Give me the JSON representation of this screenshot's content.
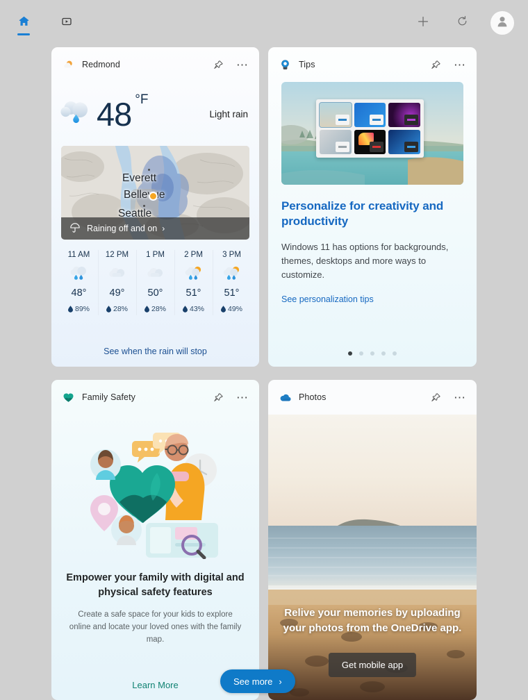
{
  "topbar": {
    "nav": [
      {
        "name": "home",
        "icon": "home-icon",
        "active": true
      },
      {
        "name": "video",
        "icon": "video-icon",
        "active": false
      }
    ],
    "actions": [
      {
        "name": "add",
        "icon": "plus-icon"
      },
      {
        "name": "refresh",
        "icon": "refresh-icon"
      },
      {
        "name": "account",
        "icon": "avatar-icon"
      }
    ]
  },
  "weather": {
    "title": "Redmond",
    "icon": "partly-sunny-icon",
    "pin_icon": "pin-icon",
    "more_icon": "more-options-icon",
    "temperature": "48",
    "unit": "°F",
    "condition": "Light rain",
    "current_icon": "rain-cloud-icon",
    "map": {
      "labels": [
        "Everett",
        "Bellevue",
        "Seattle"
      ],
      "overlay_icon": "umbrella-icon",
      "overlay_text": "Raining off and on",
      "overlay_chevron": "›"
    },
    "hourly": [
      {
        "time": "11 AM",
        "icon": "rain-icon",
        "temp": "48°",
        "precip": "89%"
      },
      {
        "time": "12 PM",
        "icon": "cloud-icon",
        "temp": "49°",
        "precip": "28%"
      },
      {
        "time": "1 PM",
        "icon": "cloud-icon",
        "temp": "50°",
        "precip": "28%"
      },
      {
        "time": "2 PM",
        "icon": "sun-rain-icon",
        "temp": "51°",
        "precip": "43%"
      },
      {
        "time": "3 PM",
        "icon": "sun-rain-icon",
        "temp": "51°",
        "precip": "49%"
      }
    ],
    "footer_link": "See when the rain will stop"
  },
  "tips": {
    "title": "Tips",
    "icon": "tips-lightbulb-icon",
    "pin_icon": "pin-icon",
    "more_icon": "more-options-icon",
    "image_alt": "personalization-settings-thumbnails",
    "headline": "Personalize for creativity and productivity",
    "body": "Windows 11 has options for backgrounds, themes, desktops and more ways to customize.",
    "link": "See personalization tips",
    "dots": 5,
    "active_dot": 0
  },
  "family": {
    "title": "Family Safety",
    "icon": "heart-icon",
    "pin_icon": "pin-icon",
    "more_icon": "more-options-icon",
    "illustration_alt": "family-safety-illustration",
    "headline": "Empower your family with digital and physical safety features",
    "body": "Create a safe space for your kids to explore online and locate your loved ones with the family map.",
    "link": "Learn More"
  },
  "photos": {
    "title": "Photos",
    "icon": "onedrive-cloud-icon",
    "pin_icon": "pin-icon",
    "more_icon": "more-options-icon",
    "image_alt": "beach-sunset-photo",
    "overlay_text": "Relive your memories by uploading your photos from the OneDrive app.",
    "button": "Get mobile app"
  },
  "see_more": {
    "label": "See more",
    "chevron": "›"
  },
  "colors": {
    "accent_blue": "#0f7ac8",
    "link_blue": "#1668c1",
    "teal": "#108272",
    "page_bg": "#d0d0d0"
  }
}
